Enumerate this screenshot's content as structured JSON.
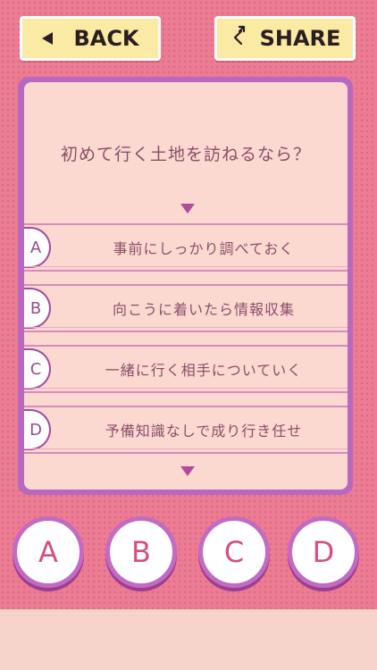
{
  "header": {
    "back_label": "BACK",
    "share_label": "SHARE"
  },
  "question": {
    "text": "初めて行く土地を訪ねるなら？"
  },
  "options": [
    {
      "letter": "A",
      "text": "事前にしっかり調べておく"
    },
    {
      "letter": "B",
      "text": "向こうに着いたら情報収集"
    },
    {
      "letter": "C",
      "text": "一緒に行く相手についていく"
    },
    {
      "letter": "D",
      "text": "予備知識なしで成り行き任せ"
    }
  ],
  "answer_buttons": [
    "A",
    "B",
    "C",
    "D"
  ],
  "colors": {
    "background_pink": "#ec7c93",
    "panel_fill": "#fbd8d0",
    "panel_border": "#b968c1",
    "button_yellow": "#fbeaa3",
    "answer_letter": "#d94f7c",
    "text": "#8b4e6a"
  },
  "icons": {
    "back": "left-triangle-icon",
    "share": "share-arrow-icon",
    "scroll_up": "triangle-down-icon",
    "scroll_down": "triangle-down-icon"
  }
}
